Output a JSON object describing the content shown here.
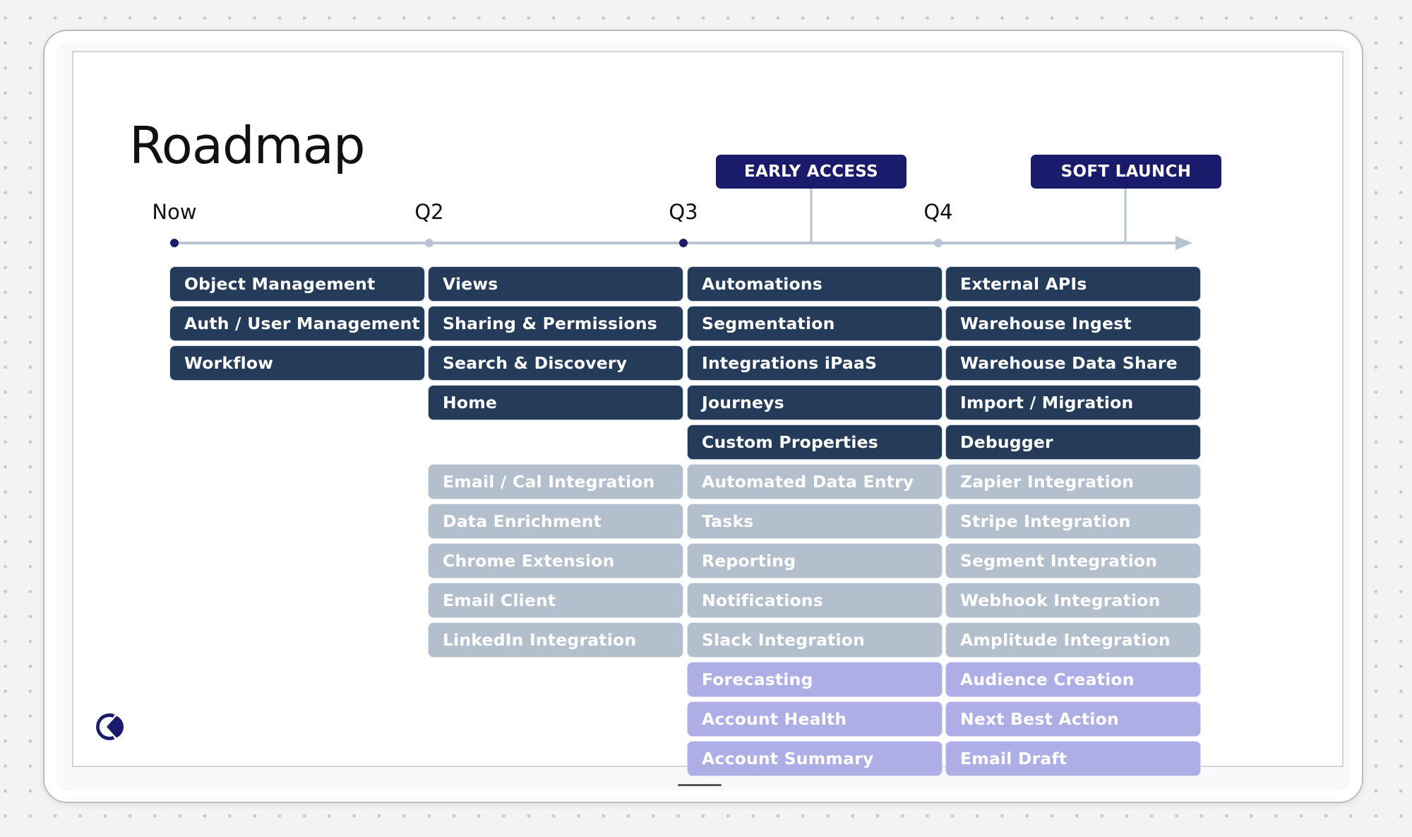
{
  "slide": {
    "title": "Roadmap"
  },
  "timeline": {
    "ticks": [
      {
        "label": "Now",
        "marker": "active"
      },
      {
        "label": "Q2",
        "marker": "inactive"
      },
      {
        "label": "Q3",
        "marker": "active"
      },
      {
        "label": "Q4",
        "marker": "inactive"
      }
    ],
    "milestones": [
      {
        "label": "EARLY ACCESS"
      },
      {
        "label": "SOFT LAUNCH"
      }
    ]
  },
  "colors": {
    "core": "#243b5a",
    "integration": "#b3bfcc",
    "ai": "#aeaee6",
    "milestone": "#1b1b6b",
    "axis": "#b8c4d1",
    "active_marker": "#1b1b6b",
    "inactive_marker": "#b8c4d1"
  },
  "columns": [
    {
      "period": "Now",
      "items": [
        {
          "label": "Object Management",
          "category": "core"
        },
        {
          "label": "Auth / User Management",
          "category": "core"
        },
        {
          "label": "Workflow",
          "category": "core"
        }
      ]
    },
    {
      "period": "Q2",
      "items": [
        {
          "label": "Views",
          "category": "core"
        },
        {
          "label": "Sharing & Permissions",
          "category": "core"
        },
        {
          "label": "Search & Discovery",
          "category": "core"
        },
        {
          "label": "Home",
          "category": "core"
        },
        {
          "label": "",
          "category": "empty"
        },
        {
          "label": "Email / Cal Integration",
          "category": "integration"
        },
        {
          "label": "Data Enrichment",
          "category": "integration"
        },
        {
          "label": "Chrome Extension",
          "category": "integration"
        },
        {
          "label": "Email Client",
          "category": "integration"
        },
        {
          "label": "LinkedIn Integration",
          "category": "integration"
        }
      ]
    },
    {
      "period": "Q3",
      "items": [
        {
          "label": "Automations",
          "category": "core"
        },
        {
          "label": "Segmentation",
          "category": "core"
        },
        {
          "label": "Integrations iPaaS",
          "category": "core"
        },
        {
          "label": "Journeys",
          "category": "core"
        },
        {
          "label": "Custom Properties",
          "category": "core"
        },
        {
          "label": "Automated Data Entry",
          "category": "integration"
        },
        {
          "label": "Tasks",
          "category": "integration"
        },
        {
          "label": "Reporting",
          "category": "integration"
        },
        {
          "label": "Notifications",
          "category": "integration"
        },
        {
          "label": "Slack Integration",
          "category": "integration"
        },
        {
          "label": "Forecasting",
          "category": "ai"
        },
        {
          "label": "Account Health",
          "category": "ai"
        },
        {
          "label": "Account Summary",
          "category": "ai"
        }
      ]
    },
    {
      "period": "Q4",
      "items": [
        {
          "label": "External APIs",
          "category": "core"
        },
        {
          "label": "Warehouse Ingest",
          "category": "core"
        },
        {
          "label": "Warehouse Data Share",
          "category": "core"
        },
        {
          "label": "Import / Migration",
          "category": "core"
        },
        {
          "label": "Debugger",
          "category": "core"
        },
        {
          "label": "Zapier Integration",
          "category": "integration"
        },
        {
          "label": "Stripe Integration",
          "category": "integration"
        },
        {
          "label": "Segment Integration",
          "category": "integration"
        },
        {
          "label": "Webhook Integration",
          "category": "integration"
        },
        {
          "label": "Amplitude Integration",
          "category": "integration"
        },
        {
          "label": "Audience Creation",
          "category": "ai"
        },
        {
          "label": "Next Best Action",
          "category": "ai"
        },
        {
          "label": "Email Draft",
          "category": "ai"
        }
      ]
    }
  ]
}
